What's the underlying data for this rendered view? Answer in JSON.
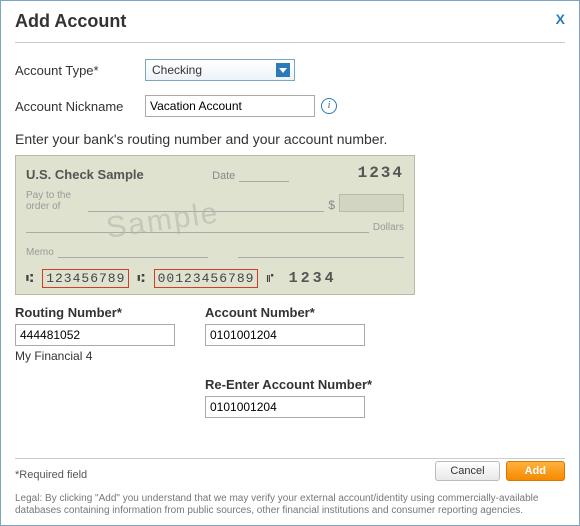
{
  "dialog": {
    "title": "Add Account"
  },
  "fields": {
    "account_type": {
      "label": "Account Type*",
      "value": "Checking"
    },
    "nickname": {
      "label": "Account Nickname",
      "value": "Vacation Account"
    },
    "routing": {
      "label": "Routing Number*",
      "value": "444481052",
      "bank_lookup": "My Financial 4"
    },
    "account": {
      "label": "Account Number*",
      "value": "0101001204"
    },
    "reenter": {
      "label": "Re-Enter Account Number*",
      "value": "0101001204"
    }
  },
  "instruction": "Enter your bank's routing number and your account number.",
  "check": {
    "name": "U.S. Check Sample",
    "date_label": "Date",
    "number": "1234",
    "pay_to": "Pay to the order of",
    "dollars": "Dollars",
    "memo": "Memo",
    "watermark": "Sample",
    "micr_routing": "123456789",
    "micr_account": "00123456789",
    "micr_check": "1234"
  },
  "buttons": {
    "cancel": "Cancel",
    "add": "Add"
  },
  "required_note": "*Required field",
  "legal": "Legal: By clicking \"Add\" you understand that we may verify your external account/identity using commercially-available databases containing information from public sources, other financial institutions and consumer reporting agencies."
}
